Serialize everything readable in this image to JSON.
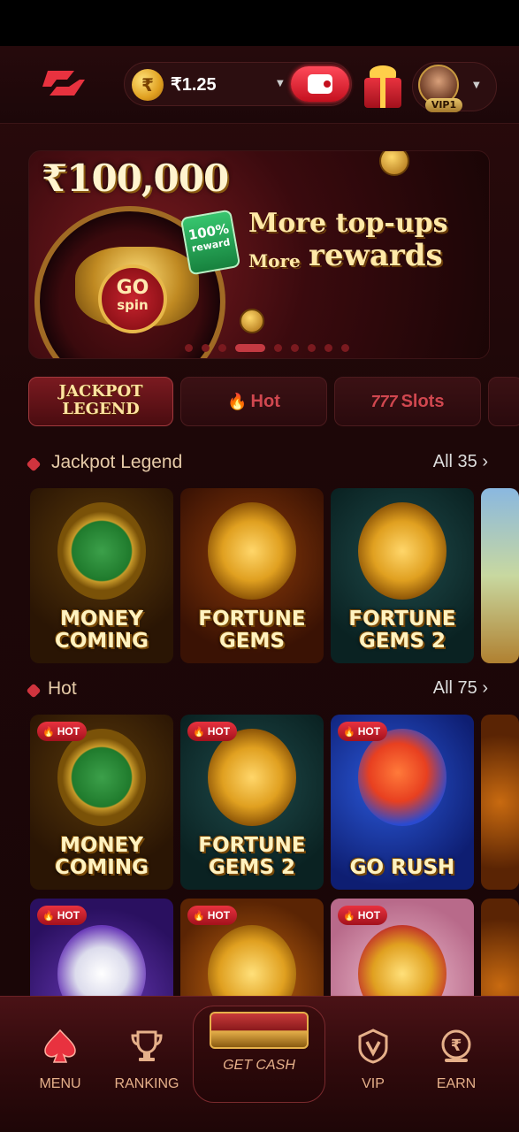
{
  "header": {
    "balance": "₹1.25",
    "coin_symbol": "₹",
    "vip_level": "VIP1"
  },
  "banner": {
    "prize": "₹100,000",
    "go": "GO",
    "spin": "spin",
    "reward_pct": "100%",
    "reward_word": "reward",
    "line1": "More top-ups",
    "line2_small": "More",
    "line2_big": "rewards",
    "slide_count": 9,
    "active_slide": 4
  },
  "tabs": [
    {
      "label": "JACKPOT LEGEND",
      "active": true
    },
    {
      "label": "Hot",
      "icon": "flame-icon"
    },
    {
      "label": "Slots",
      "icon": "777-icon"
    }
  ],
  "sections": {
    "jackpot": {
      "title": "Jackpot Legend",
      "all": "All 35 ›"
    },
    "hot": {
      "title": "Hot",
      "all": "All 75 ›"
    }
  },
  "jackpot_games": [
    {
      "title": "MONEY COMING"
    },
    {
      "title": "FORTUNE GEMS"
    },
    {
      "title": "FORTUNE GEMS 2"
    }
  ],
  "hot_games": [
    {
      "title": "MONEY COMING",
      "badge": "HOT"
    },
    {
      "title": "FORTUNE GEMS 2",
      "badge": "HOT"
    },
    {
      "title": "GO RUSH",
      "badge": "HOT"
    }
  ],
  "hot_games_row2": [
    {
      "badge": "HOT"
    },
    {
      "badge": "HOT"
    },
    {
      "badge": "HOT"
    }
  ],
  "nav": {
    "menu": "MENU",
    "ranking": "RANKING",
    "get_cash": "GET CASH",
    "vip": "VIP",
    "earn": "EARN"
  },
  "colors": {
    "accent": "#d0343e",
    "gold": "#ffe4a0",
    "background": "#1d0708"
  }
}
